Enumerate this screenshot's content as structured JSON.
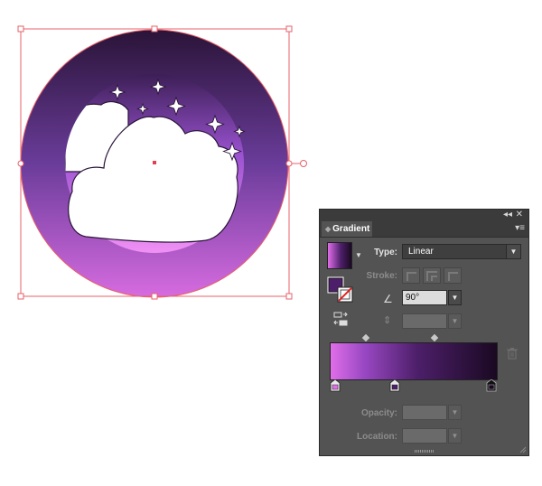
{
  "panel": {
    "title": "Gradient",
    "collapse_glyph": "◂◂",
    "close_glyph": "✕",
    "menu_glyph": "▾≡",
    "type_label": "Type:",
    "type_value": "Linear",
    "stroke_label": "Stroke:",
    "angle_value": "90°",
    "opacity_label": "Opacity:",
    "location_label": "Location:",
    "dropdown_glyph": "▼",
    "gradient_stops": [
      {
        "color": "#e06ee8",
        "location": 0
      },
      {
        "color": "#4d1f6a",
        "location": 52
      },
      {
        "color": "#1a0922",
        "location": 100
      }
    ]
  },
  "colors": {
    "panel_bg": "#535353",
    "selection": "#e8606a",
    "sky_light": "#e68af0",
    "sky_dark": "#2a1438",
    "cloud": "#ffffff"
  },
  "icons": [
    "collapse-icon",
    "close-icon",
    "panel-menu-icon",
    "angle-icon",
    "aspect-ratio-icon",
    "reverse-gradient-icon",
    "trash-icon",
    "fill-stroke-icon"
  ]
}
